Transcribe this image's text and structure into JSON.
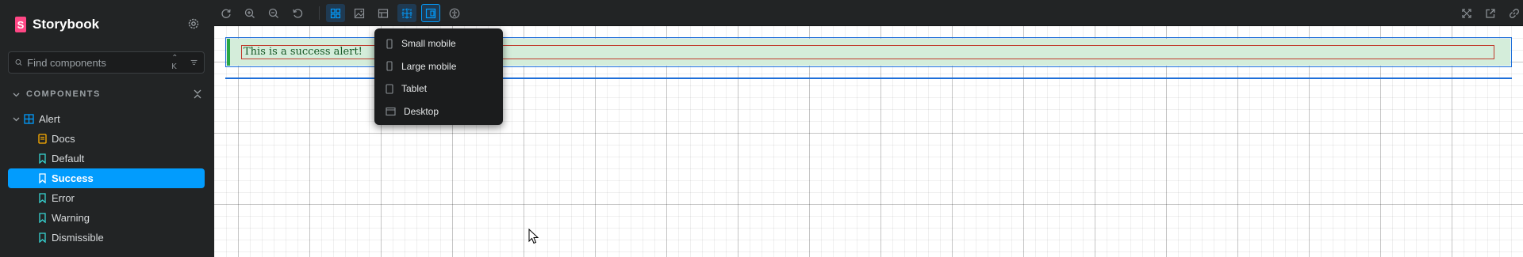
{
  "app": {
    "brand_name": "Storybook",
    "brand_letter": "S"
  },
  "sidebar": {
    "search": {
      "placeholder": "Find components",
      "shortcut": "⌃ K"
    },
    "section_title": "COMPONENTS",
    "component": {
      "label": "Alert"
    },
    "stories": [
      {
        "label": "Docs",
        "kind": "docs",
        "selected": false
      },
      {
        "label": "Default",
        "kind": "story",
        "selected": false
      },
      {
        "label": "Success",
        "kind": "story",
        "selected": true
      },
      {
        "label": "Error",
        "kind": "story",
        "selected": false
      },
      {
        "label": "Warning",
        "kind": "story",
        "selected": false
      },
      {
        "label": "Dismissible",
        "kind": "story",
        "selected": false
      }
    ]
  },
  "toolbar": {
    "left_icons": [
      "reload-icon",
      "zoom-in-icon",
      "zoom-out-icon",
      "reset-zoom-icon",
      "grid-icon",
      "image-icon",
      "outline-rows-icon",
      "measure-icon",
      "viewport-icon",
      "accessibility-icon"
    ],
    "right_icons": [
      "fullscreen-icon",
      "open-new-tab-icon",
      "copy-link-icon"
    ]
  },
  "viewport_menu": {
    "items": [
      {
        "label": "Small mobile",
        "icon": "mobile-icon"
      },
      {
        "label": "Large mobile",
        "icon": "mobile-icon"
      },
      {
        "label": "Tablet",
        "icon": "tablet-icon"
      },
      {
        "label": "Desktop",
        "icon": "desktop-icon"
      }
    ]
  },
  "preview": {
    "alert_text": "This is a success alert!"
  },
  "colors": {
    "accent": "#029cfd",
    "brand": "#ff4785",
    "success_bg": "#d4edda",
    "success_border": "#28a745",
    "success_text": "#155724"
  }
}
